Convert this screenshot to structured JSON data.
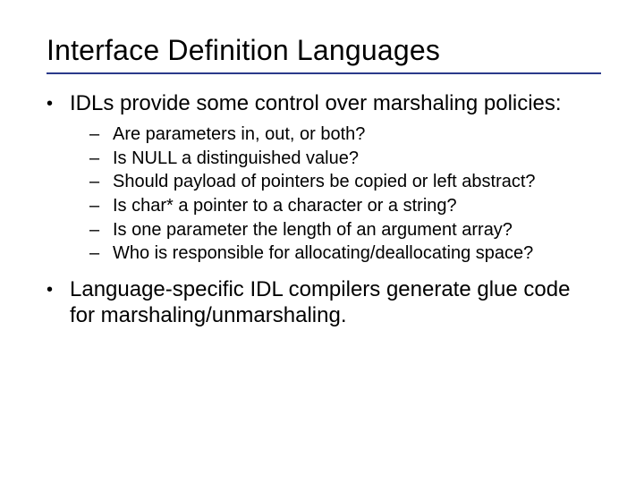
{
  "title": "Interface Definition Languages",
  "bullets": [
    {
      "text": "IDLs provide some control over marshaling policies:",
      "subitems": [
        "Are parameters in, out, or both?",
        "Is NULL a distinguished value?",
        "Should payload of pointers be copied or left abstract?",
        "Is char* a pointer to a character or a string?",
        "Is one parameter the length of an argument array?",
        "Who is responsible for allocating/deallocating space?"
      ]
    },
    {
      "text": "Language-specific IDL compilers generate glue code for marshaling/unmarshaling.",
      "subitems": []
    }
  ]
}
